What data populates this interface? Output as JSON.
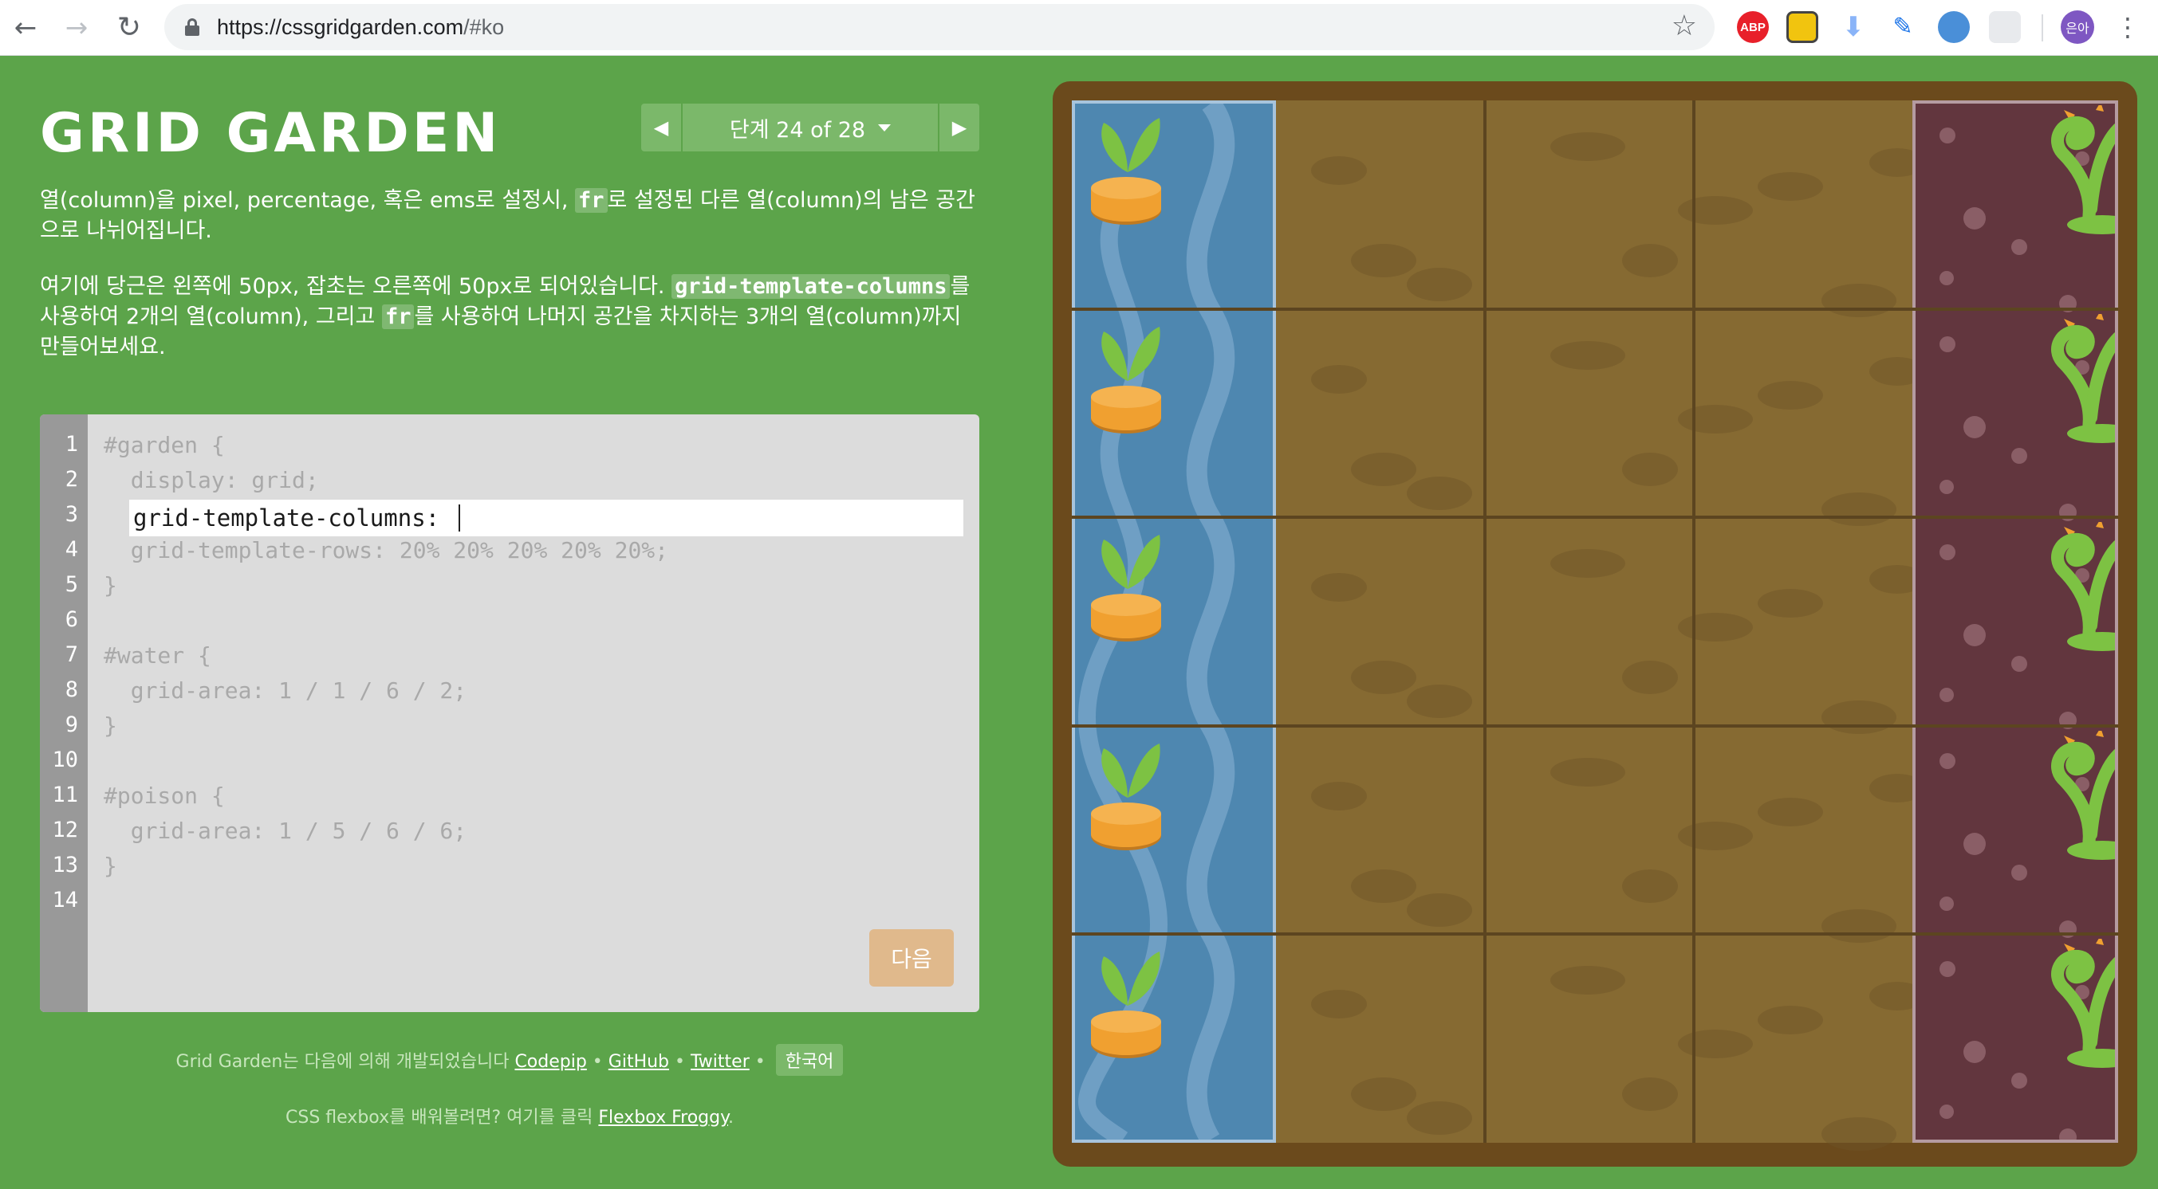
{
  "browser": {
    "url_host": "https://cssgridgarden.com",
    "url_path": "/#ko",
    "ext_abp": "ABP",
    "avatar_text": "은아"
  },
  "header": {
    "title": "GRID GARDEN",
    "level_label": "단계 24 of 28"
  },
  "instructions": {
    "p1_a": "열(column)을 pixel, percentage, 혹은 ems로 설정시, ",
    "p1_code": "fr",
    "p1_b": "로 설정된 다른 열(column)의 남은 공간으로 나뉘어집니다.",
    "p2_a": "여기에 당근은 왼쪽에 50px, 잡초는 오른쪽에 50px로 되어있습니다. ",
    "p2_code1": "grid-template-columns",
    "p2_b": "를 사용하여 2개의 열(column), 그리고 ",
    "p2_code2": "fr",
    "p2_c": "를 사용하여 나머지 공간을 차지하는 3개의 열(column)까지 만들어보세요."
  },
  "editor": {
    "line_numbers": [
      "1",
      "2",
      "3",
      "4",
      "5",
      "6",
      "7",
      "8",
      "9",
      "10",
      "11",
      "12",
      "13",
      "14"
    ],
    "lines": [
      "#garden {",
      "  display: grid;",
      "",
      "  grid-template-rows: 20% 20% 20% 20% 20%;",
      "}",
      "",
      "#water {",
      "  grid-area: 1 / 1 / 6 / 2;",
      "}",
      "",
      "#poison {",
      "  grid-area: 1 / 5 / 6 / 6;",
      "}",
      ""
    ],
    "input_prefix": "grid-template-columns: ",
    "input_value": "",
    "next_label": "다음"
  },
  "footer": {
    "credit_text": "Grid Garden는 다음에 의해 개발되었습니다 ",
    "link_codepip": "Codepip",
    "link_github": "GitHub",
    "link_twitter": "Twitter",
    "sep": " • ",
    "lang_button": "한국어",
    "flexbox_text": "CSS flexbox를 배워볼려면? 여기를 클릭 ",
    "link_froggy": "Flexbox Froggy",
    "flexbox_end": "."
  },
  "garden": {
    "rows": 5,
    "columns": 5,
    "colors": {
      "soil": "#866a32",
      "water": "#4e87b0",
      "poison": "#62363e",
      "carrot": "#f0a030",
      "leaf": "#7dc243"
    }
  }
}
